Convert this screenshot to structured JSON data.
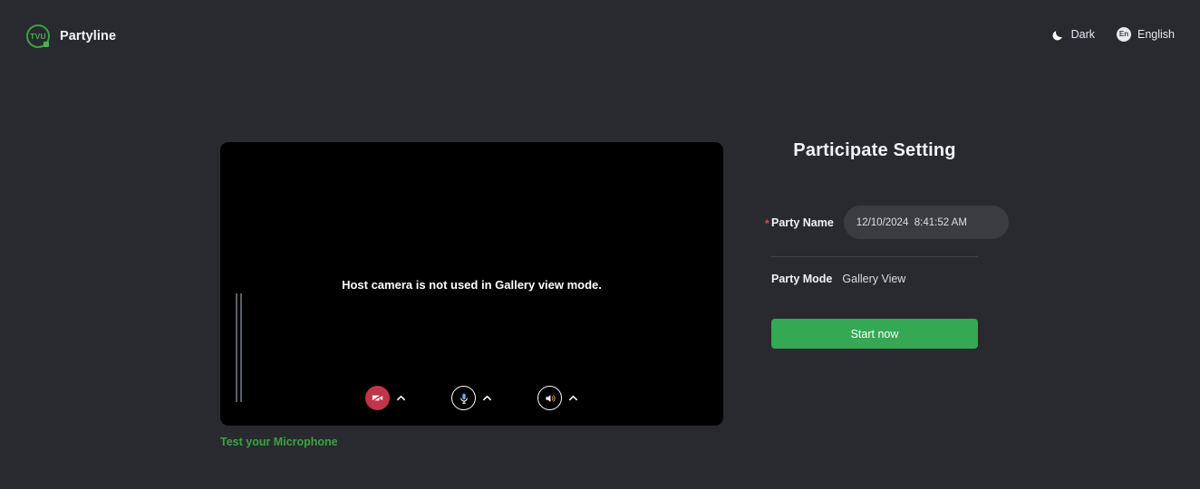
{
  "colors": {
    "background": "#282a30",
    "accent_green": "#34a853",
    "link_green": "#3aa33f",
    "danger_red": "#c0354a",
    "required_red": "#e8464e",
    "input_bg": "#3a3c42",
    "text_primary": "#f2f3f5"
  },
  "header": {
    "logo_text": "TVU",
    "logo_icon": "tvu-logo-icon",
    "brand_name": "Partyline",
    "theme_toggle": {
      "label": "Dark",
      "icon": "moon-icon"
    },
    "language_selector": {
      "label": "English",
      "badge": "En",
      "icon": "language-icon"
    }
  },
  "video_preview": {
    "message": "Host camera is not used in Gallery view mode.",
    "vu_meter": "audio-level-meter",
    "controls": [
      {
        "name": "camera-toggle",
        "icon": "camera-off-icon",
        "state": "off",
        "chevron": "chevron-up-icon"
      },
      {
        "name": "microphone-toggle",
        "icon": "microphone-icon",
        "state": "on",
        "chevron": "chevron-up-icon"
      },
      {
        "name": "speaker-toggle",
        "icon": "speaker-icon",
        "state": "on",
        "chevron": "chevron-up-icon"
      }
    ],
    "test_microphone_link": "Test your Microphone"
  },
  "settings": {
    "title": "Participate Setting",
    "party_name": {
      "label": "Party Name",
      "required_marker": "*",
      "value": "12/10/2024  8:41:52 AM",
      "placeholder": "Party Name"
    },
    "party_mode": {
      "label": "Party Mode",
      "value": "Gallery View"
    },
    "start_button": "Start now"
  }
}
